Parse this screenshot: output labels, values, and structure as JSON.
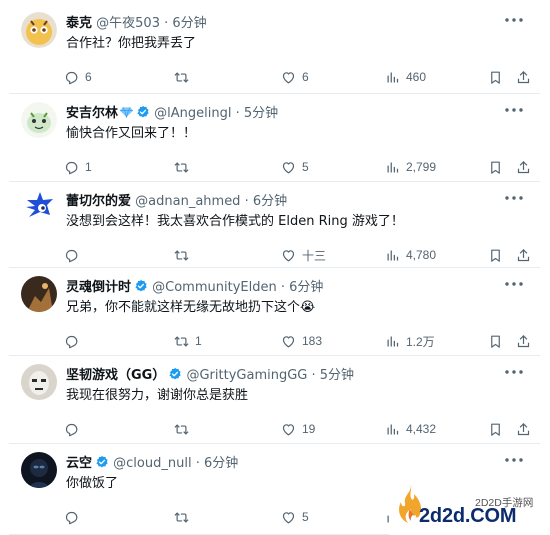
{
  "tweets": [
    {
      "name": "泰克",
      "handle": "@午夜503",
      "time": "6分钟",
      "verified": false,
      "badge": null,
      "text": "合作社？你把我弄丢了",
      "stats": {
        "replies": "6",
        "reposts": "",
        "likes": "6",
        "views": "460"
      },
      "avatar_colors": [
        "#f2c14e",
        "#6b3f1d"
      ]
    },
    {
      "name": "安吉尔林",
      "handle": "@lAngelingl",
      "time": "5分钟",
      "verified": true,
      "badge": "gem",
      "text": "愉快合作又回来了！！",
      "stats": {
        "replies": "1",
        "reposts": "",
        "likes": "5",
        "views": "2,799"
      },
      "avatar_colors": [
        "#cfe8c7",
        "#5a9a3a"
      ]
    },
    {
      "name": "蕾切尔的爱",
      "handle": "@adnan_ahmed",
      "time": "6分钟",
      "verified": false,
      "badge": null,
      "text": "没想到会这样！我太喜欢合作模式的 Elden Ring 游戏了！",
      "stats": {
        "replies": "",
        "reposts": "",
        "likes": "十三",
        "views": "4,780"
      },
      "avatar_colors": [
        "#1e4fd6",
        "#ffffff"
      ]
    },
    {
      "name": "灵魂倒计时",
      "handle": "@CommunityElden",
      "time": "6分钟",
      "verified": true,
      "badge": null,
      "text": "兄弟，你不能就这样无缘无故地扔下这个😭",
      "stats": {
        "replies": "",
        "reposts": "1",
        "likes": "183",
        "views": "1.2万"
      },
      "avatar_colors": [
        "#3a2a1e",
        "#a3703a"
      ]
    },
    {
      "name": "坚韧游戏（GG）",
      "handle": "@GrittyGamingGG",
      "time": "5分钟",
      "verified": true,
      "badge": null,
      "text": "我现在很努力，谢谢你总是获胜",
      "stats": {
        "replies": "",
        "reposts": "",
        "likes": "19",
        "views": "4,432"
      },
      "avatar_colors": [
        "#d9d4cc",
        "#2b2b2b"
      ]
    },
    {
      "name": "云空",
      "handle": "@cloud_null",
      "time": "6分钟",
      "verified": true,
      "badge": null,
      "text": "你做饭了",
      "stats": {
        "replies": "",
        "reposts": "",
        "likes": "5",
        "views": ""
      },
      "avatar_colors": [
        "#0e1420",
        "#5a7fb0"
      ]
    }
  ],
  "watermark": {
    "sub": "2D2D手游网",
    "main": "2d2d.COM"
  },
  "colors": {
    "text": "#0f1419",
    "muted": "#536471",
    "verified": "#1d9bf0",
    "border": "#e6ecf0",
    "watermark_blue": "#0c2c6e",
    "watermark_flame": "#f2a52b"
  },
  "icons": {
    "reply": "reply-icon",
    "repost": "repost-icon",
    "like": "heart-icon",
    "views": "views-chart-icon",
    "bookmark": "bookmark-icon",
    "share": "share-icon",
    "more": "more-dots-icon",
    "verified": "verified-badge-icon"
  }
}
